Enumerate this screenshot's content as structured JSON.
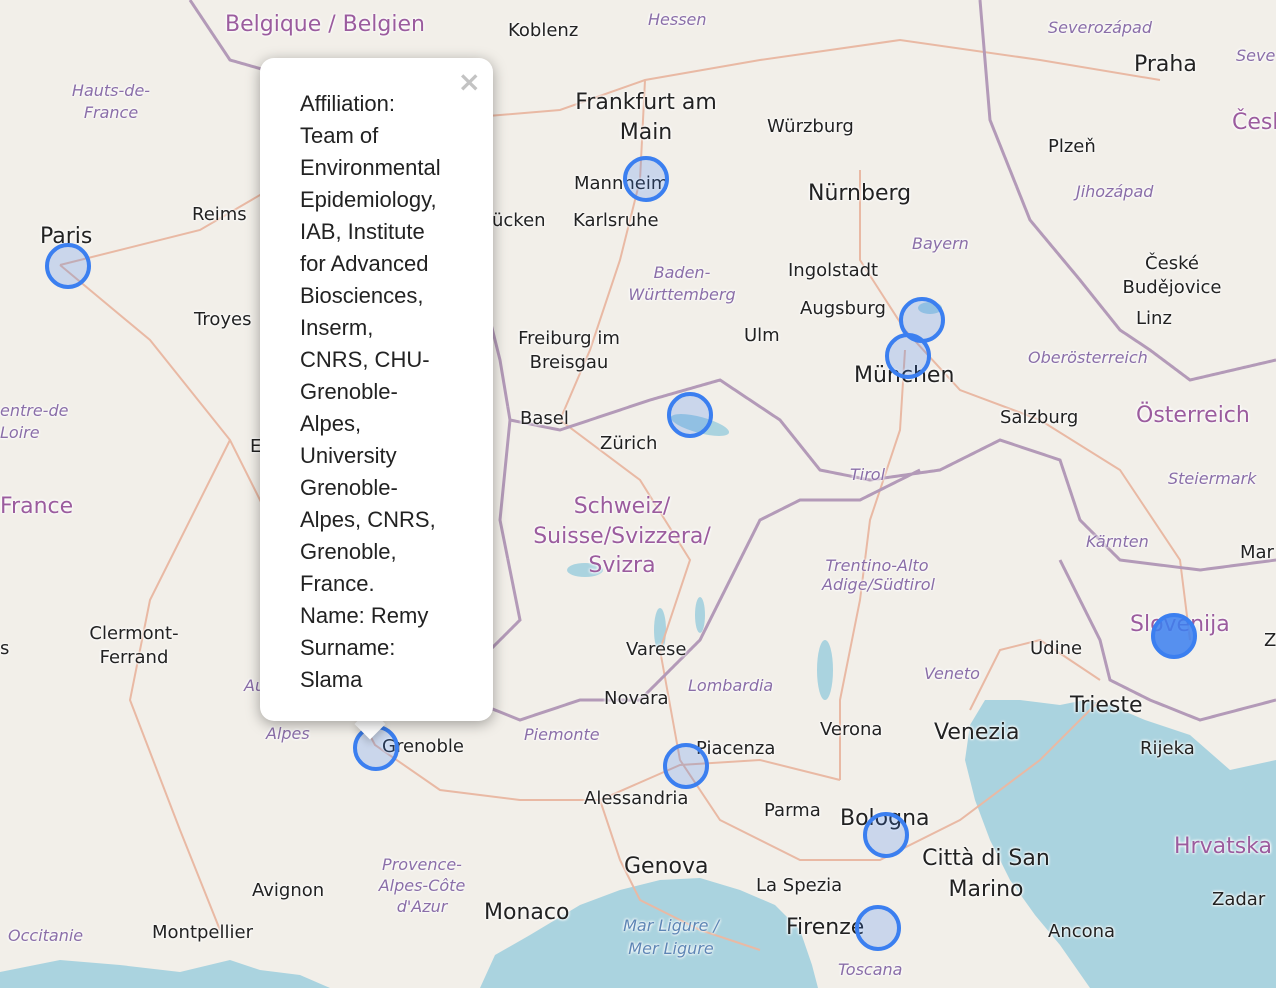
{
  "map": {
    "labels": {
      "belgique": "Belgique / Belgien",
      "koblenz": "Koblenz",
      "hessen": "Hessen",
      "severozapad": "Severozápad",
      "seve": "Seve",
      "praha": "Praha",
      "cesk": "Česk",
      "hauts": "Hauts-de-France",
      "frankfurt": "Frankfurt am Main",
      "wurzburg": "Würzburg",
      "plzen": "Plzeň",
      "mannheim": "Mannheim",
      "nurnberg": "Nürnberg",
      "jihozapad": "Jihozápad",
      "reims": "Reims",
      "saarbrucken": "ücken",
      "karlsruhe": "Karlsruhe",
      "paris": "Paris",
      "bayern": "Bayern",
      "ceske": "České Budějovice",
      "baden": "Baden-Württemberg",
      "ingolstadt": "Ingolstadt",
      "augsburg": "Augsburg",
      "linz": "Linz",
      "troyes": "Troyes",
      "freiburg": "Freiburg im Breisgau",
      "ulm": "Ulm",
      "munchen": "München",
      "oberosterreich": "Oberösterreich",
      "centre": "entre-de Loire",
      "basel": "Basel",
      "salzburg": "Salzburg",
      "osterreich": "Österreich",
      "zurich": "Zürich",
      "tirol": "Tirol",
      "steiermark": "Steiermark",
      "france": "France",
      "schweiz": "Schweiz/ Suisse/Svizzera/ Svizra",
      "karnten": "Kärnten",
      "mar": "Mar",
      "trentino": "Trentino-Alto Adige/Südtirol",
      "clermont": "Clermont-Ferrand",
      "slovenija": "Slovenija",
      "varese": "Varese",
      "udine": "Udine",
      "veneto": "Veneto",
      "novara": "Novara",
      "lombardia": "Lombardia",
      "trieste": "Trieste",
      "piemonte": "Piemonte",
      "verona": "Verona",
      "venezia": "Venezia",
      "alpes": "Alpes",
      "grenoble": "Grenoble",
      "piacenza": "Piacenza",
      "rijeka": "Rijeka",
      "alessandria": "Alessandria",
      "parma": "Parma",
      "bologna": "Bologna",
      "hrvatska": "Hrvatska",
      "provence": "Provence-Alpes-Côte d'Azur",
      "genova": "Genova",
      "citta": "Città di San Marino",
      "avignon": "Avignon",
      "laspezia": "La Spezia",
      "zadar": "Zadar",
      "monaco": "Monaco",
      "marligure": "Mar Ligure / Mer Ligure",
      "firenze": "Firenze",
      "ancona": "Ancona",
      "occitanie": "Occitanie",
      "montpellier": "Montpellier",
      "toscana": "Toscana",
      "au": "Au",
      "s_left": "s",
      "e_mid": "E",
      "z_right": "Z"
    }
  },
  "popup": {
    "close": "×",
    "lines": [
      "Affiliation:",
      "Team of",
      "Environmental",
      "Epidemiology,",
      "IAB, Institute",
      "for Advanced",
      "Biosciences,",
      "Inserm,",
      "CNRS, CHU-",
      "Grenoble-",
      "Alpes,",
      "University",
      "Grenoble-",
      "Alpes, CNRS,",
      "Grenoble,",
      "France.",
      "Name: Remy",
      "Surname:",
      "Slama"
    ]
  },
  "colors": {
    "marker": "#3b7ff0",
    "land": "#f2efe9",
    "sea": "#aad3df",
    "border": "#b39ab8"
  }
}
